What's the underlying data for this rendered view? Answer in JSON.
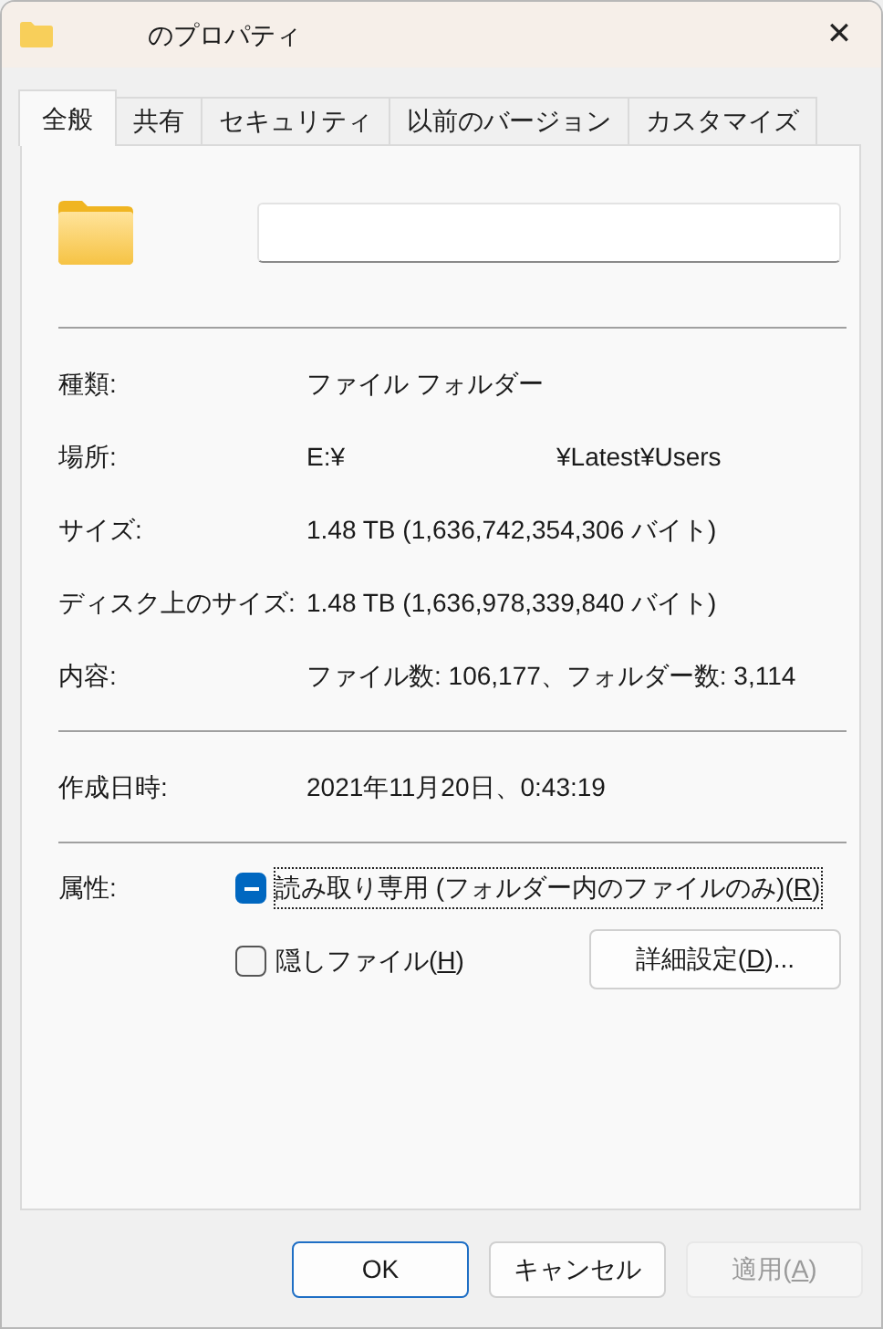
{
  "window": {
    "title": "のプロパティ",
    "close": "✕"
  },
  "tabs": [
    {
      "label": "全般",
      "selected": true
    },
    {
      "label": "共有",
      "selected": false
    },
    {
      "label": "セキュリティ",
      "selected": false
    },
    {
      "label": "以前のバージョン",
      "selected": false
    },
    {
      "label": "カスタマイズ",
      "selected": false
    }
  ],
  "sections": [
    [
      {
        "label": "種類:",
        "values": [
          "ファイル フォルダー"
        ]
      },
      {
        "label": "場所:",
        "values": [
          "E:¥",
          "¥Latest¥Users"
        ]
      },
      {
        "label": "サイズ:",
        "values": [
          "1.48 TB (1,636,742,354,306 バイト)"
        ]
      },
      {
        "label": "ディスク上のサイズ:",
        "values": [
          "1.48 TB (1,636,978,339,840 バイト)"
        ]
      },
      {
        "label": "内容:",
        "values": [
          "ファイル数: 106,177、フォルダー数: 3,114"
        ]
      }
    ],
    [
      {
        "label": "作成日時:",
        "values": [
          "2021年11月20日、0:43:19"
        ]
      }
    ]
  ],
  "attributes": {
    "label": "属性:",
    "checkboxes": [
      {
        "before": "読み取り専用 (フォルダー内のファイルのみ)(",
        "key": "R",
        "after": ")",
        "checked": true,
        "indeterminate": true,
        "focused": true
      },
      {
        "before": "隠しファイル(",
        "key": "H",
        "after": ")",
        "checked": false,
        "indeterminate": false,
        "focused": false
      }
    ],
    "advanced_button": {
      "before": "詳細設定(",
      "key": "D",
      "after": ")..."
    }
  },
  "buttons": [
    {
      "before": "OK",
      "default": true,
      "disabled": false
    },
    {
      "before": "キャンセル",
      "default": false,
      "disabled": false
    },
    {
      "before": "適用(",
      "key": "A",
      "after": ")",
      "default": false,
      "disabled": true
    }
  ]
}
